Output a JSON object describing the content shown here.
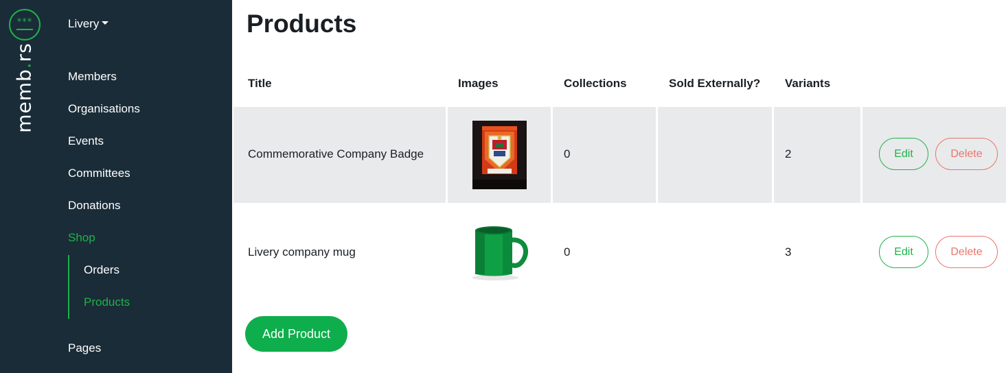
{
  "brand": {
    "name_main": "memb",
    "name_dot": ".",
    "name_tail": "rs",
    "logo_stars": "***"
  },
  "sidebar": {
    "org_switcher": "Livery",
    "items": [
      "Members",
      "Organisations",
      "Events",
      "Committees",
      "Donations",
      "Shop",
      "Pages"
    ],
    "active_item": "Shop",
    "shop_subitems": [
      "Orders",
      "Products"
    ],
    "active_subitem": "Products"
  },
  "page": {
    "title": "Products"
  },
  "table": {
    "columns": [
      "Title",
      "Images",
      "Collections",
      "Sold Externally?",
      "Variants"
    ],
    "rows": [
      {
        "title": "Commemorative Company Badge",
        "image": "badge-image",
        "collections": "0",
        "sold_externally": "",
        "variants": "2",
        "edit_label": "Edit",
        "delete_label": "Delete"
      },
      {
        "title": "Livery company mug",
        "image": "green-mug-image",
        "collections": "0",
        "sold_externally": "",
        "variants": "3",
        "edit_label": "Edit",
        "delete_label": "Delete"
      }
    ]
  },
  "actions": {
    "add_product": "Add Product"
  },
  "colors": {
    "sidebar_bg": "#1a2c38",
    "accent_green": "#1fb24a",
    "button_green": "#0fae4c",
    "delete_red": "#e8756a",
    "row_highlight": "#e9eaec"
  }
}
